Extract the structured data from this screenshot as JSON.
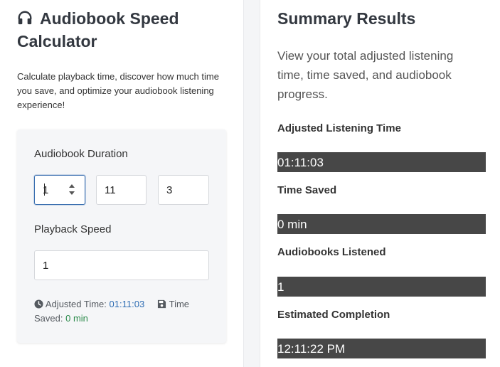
{
  "app": {
    "title": "Audiobook Speed Calculator",
    "icon": "headphones-icon",
    "description": "Calculate playback time, discover how much time you save, and optimize your audiobook listening experience!"
  },
  "form": {
    "duration_label": "Audiobook Duration",
    "hours_value": "1",
    "minutes_value": "11",
    "seconds_value": "3",
    "speed_label": "Playback Speed",
    "speed_value": "1",
    "status": {
      "adjusted_label": "Adjusted Time:",
      "adjusted_value": "01:11:03",
      "saved_label": "Time Saved:",
      "saved_value": "0 min",
      "clock_icon": "clock-icon",
      "save_icon": "floppy-disk-icon"
    }
  },
  "summary": {
    "title": "Summary Results",
    "description": "View your total adjusted listening time, time saved, and audiobook progress.",
    "results": [
      {
        "label": "Adjusted Listening Time",
        "value": "01:11:03"
      },
      {
        "label": "Time Saved",
        "value": "0 min"
      },
      {
        "label": "Audiobooks Listened",
        "value": "1"
      },
      {
        "label": "Estimated Completion",
        "value": "12:11:22 PM"
      }
    ]
  },
  "colors": {
    "heading": "#333840",
    "card_bg": "#f5f6f8",
    "result_bar_bg": "#474747",
    "adjusted_value": "#2f6db3",
    "saved_value": "#2a8a4a",
    "focus_border": "#3a6fb0"
  }
}
